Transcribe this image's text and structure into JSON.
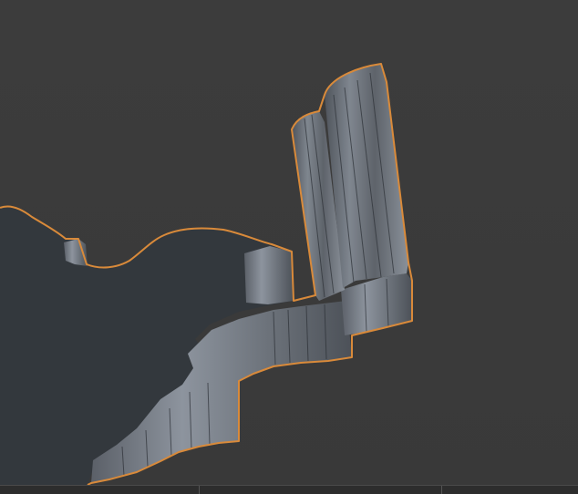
{
  "viewport": {
    "background_color": "#3b3b3b",
    "selection_outline_color": "#d98a3a",
    "mesh_top_color": "#33383d",
    "mesh_side_color": "#7a818b",
    "selected_object": "extruded-terrain-mesh"
  }
}
